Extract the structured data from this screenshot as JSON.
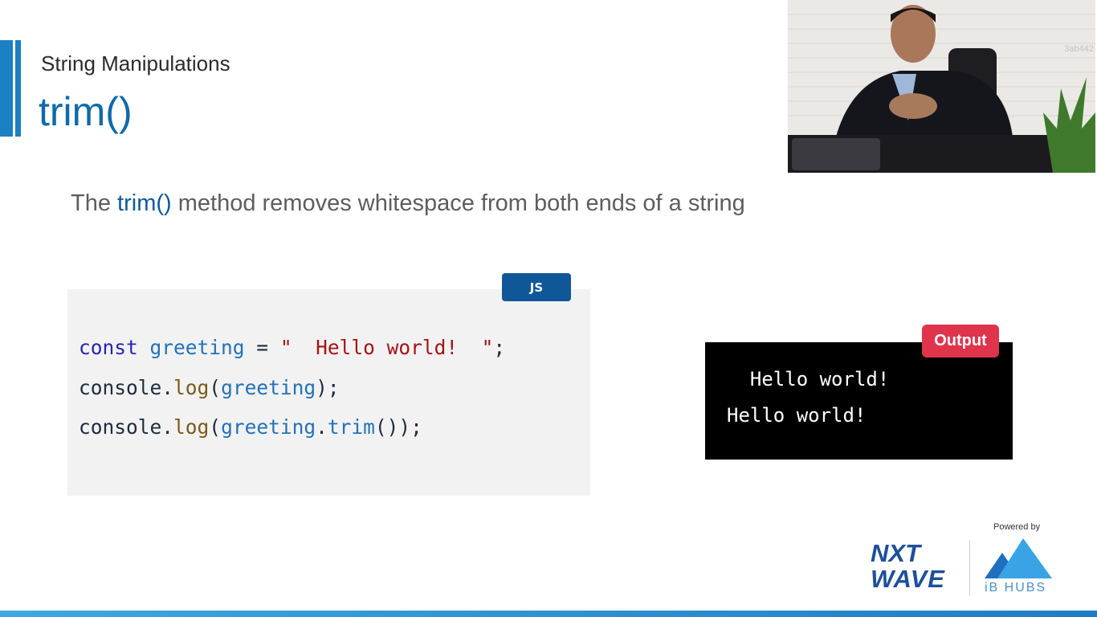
{
  "slide": {
    "section_title": "String Manipulations",
    "topic_title": "trim()",
    "description": {
      "prefix": "The ",
      "highlight": "trim()",
      "suffix": " method removes whitespace from both ends of a string"
    }
  },
  "code": {
    "language_badge": "JS",
    "line1": {
      "kw": "const",
      "name": "greeting",
      "eq": " = ",
      "str": "\"  Hello world!  \"",
      "end": ";"
    },
    "line2": {
      "obj": "console",
      "dot": ".",
      "method": "log",
      "open": "(",
      "arg": "greeting",
      "close": ");"
    },
    "line3": {
      "obj": "console",
      "dot": ".",
      "method": "log",
      "open": "(",
      "arg": "greeting",
      "dot2": ".",
      "method2": "trim",
      "close": "());"
    }
  },
  "output": {
    "badge": "Output",
    "lines": [
      "  Hello world!",
      "Hello world!"
    ]
  },
  "video": {
    "overlay_id": "3ab442"
  },
  "branding": {
    "powered_by": "Powered by",
    "nxt": "NXT",
    "wave": "WAVE",
    "ib_hubs": "iB HUBS"
  },
  "colors": {
    "accent": "#1b7fc4",
    "title_blue": "#0e6aa8",
    "badge_js": "#10579a",
    "badge_output": "#e0334c",
    "code_bg": "#f2f2f2",
    "output_bg": "#000000"
  }
}
